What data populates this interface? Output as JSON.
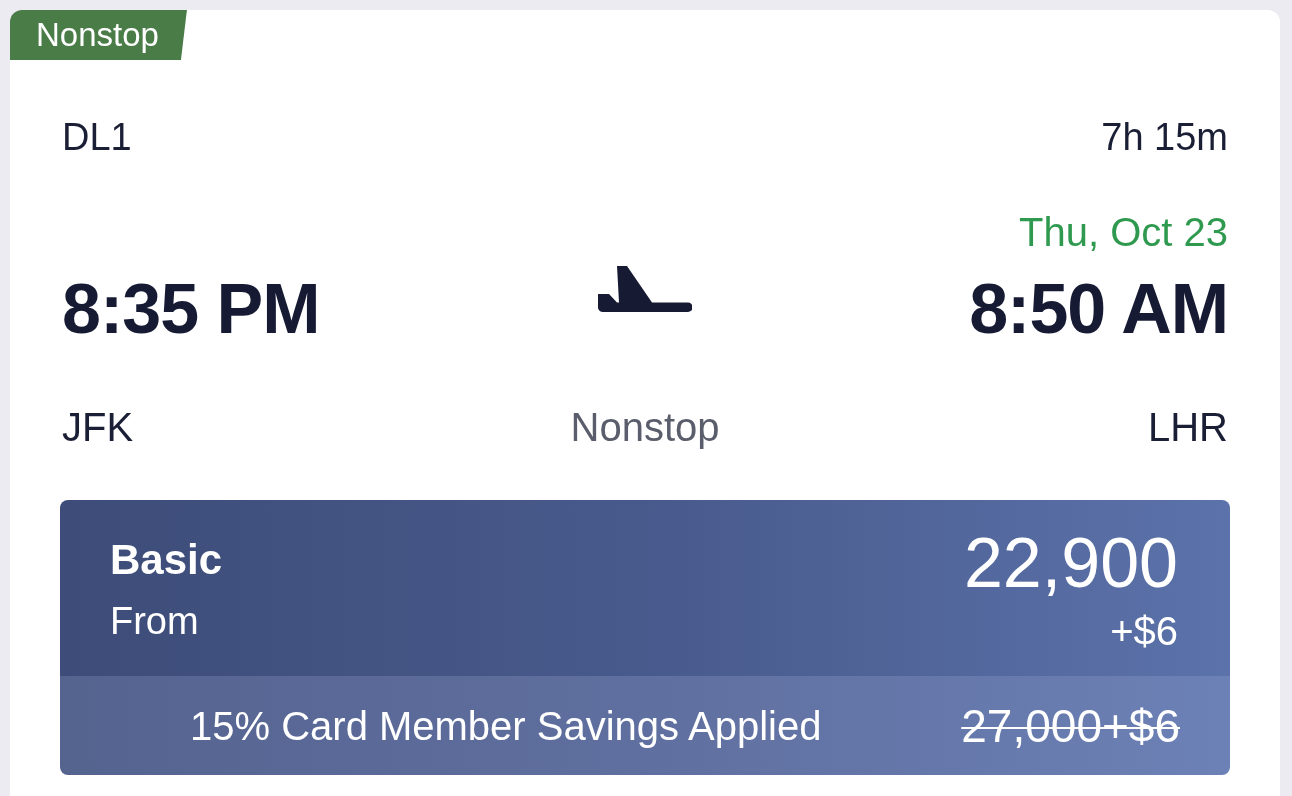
{
  "badge": {
    "label": "Nonstop"
  },
  "flight": {
    "number": "DL1",
    "duration": "7h 15m",
    "arrival_date": "Thu, Oct 23",
    "departure_time": "8:35 PM",
    "arrival_time": "8:50 AM",
    "origin": "JFK",
    "stops": "Nonstop",
    "destination": "LHR"
  },
  "fare": {
    "cabin": "Basic",
    "from_label": "From",
    "miles": "22,900",
    "fee": "+$6",
    "savings": "15% Card Member Savings Applied",
    "original_price": "27,000+$6"
  }
}
